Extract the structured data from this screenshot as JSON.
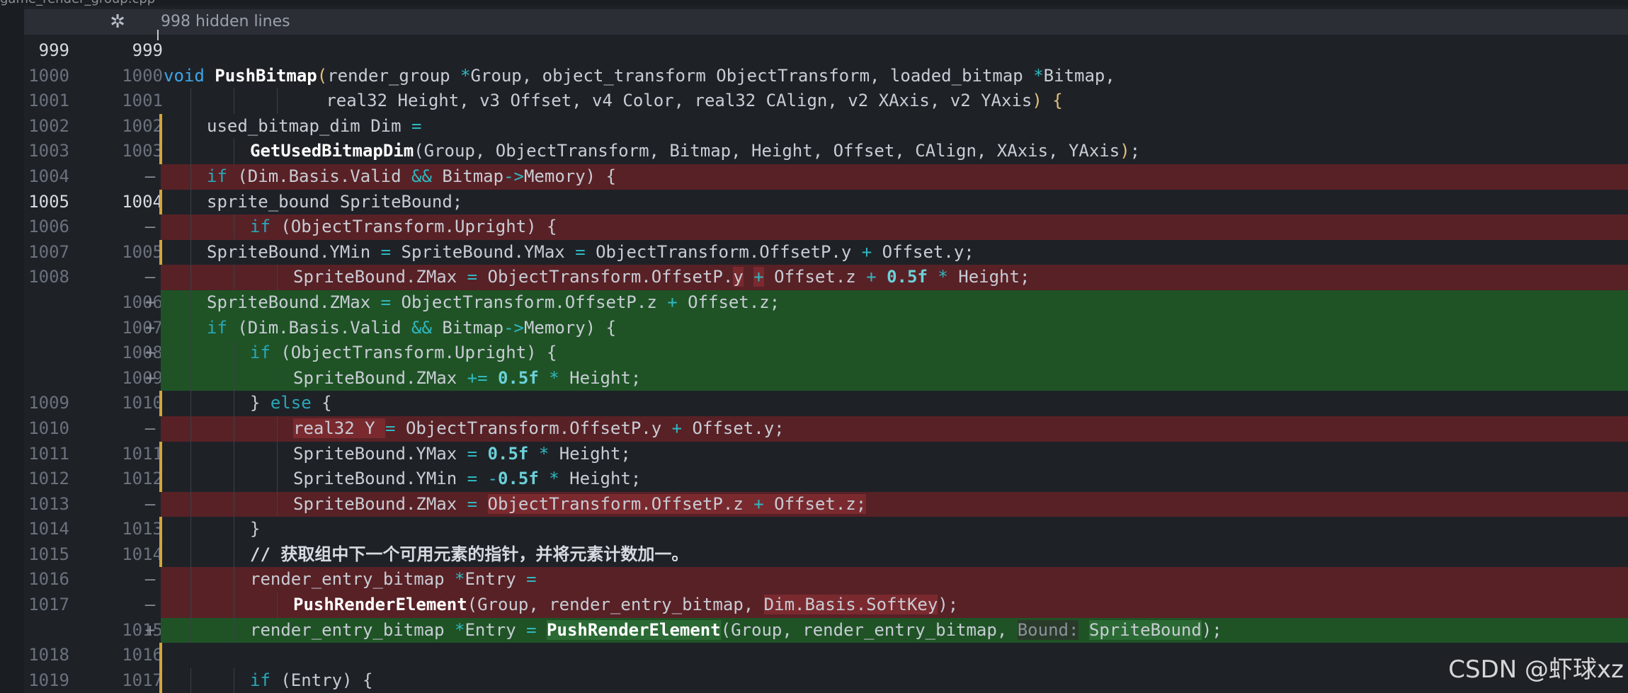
{
  "breadcrumb": "game_render_group.cpp",
  "hidden": {
    "icon": "unfold-icon",
    "label": "998 hidden lines"
  },
  "rows": [
    {
      "old": "999",
      "new": "999",
      "mark": "",
      "type": "ctx",
      "cur": true
    },
    {
      "old": "1000",
      "new": "1000",
      "mark": "",
      "type": "ctx"
    },
    {
      "old": "1001",
      "new": "1001",
      "mark": "",
      "type": "ctx"
    },
    {
      "old": "1002",
      "new": "1002",
      "mark": "",
      "type": "ctx"
    },
    {
      "old": "1003",
      "new": "1003",
      "mark": "",
      "type": "ctx"
    },
    {
      "old": "1004",
      "new": "",
      "mark": "–",
      "type": "del"
    },
    {
      "old": "1005",
      "new": "1004",
      "mark": "",
      "type": "ctx",
      "cur": true
    },
    {
      "old": "1006",
      "new": "",
      "mark": "–",
      "type": "del"
    },
    {
      "old": "1007",
      "new": "1005",
      "mark": "",
      "type": "ctx"
    },
    {
      "old": "1008",
      "new": "",
      "mark": "–",
      "type": "del"
    },
    {
      "old": "",
      "new": "1006",
      "mark": "+",
      "type": "add"
    },
    {
      "old": "",
      "new": "1007",
      "mark": "+",
      "type": "add"
    },
    {
      "old": "",
      "new": "1008",
      "mark": "+",
      "type": "add"
    },
    {
      "old": "",
      "new": "1009",
      "mark": "+",
      "type": "add"
    },
    {
      "old": "1009",
      "new": "1010",
      "mark": "",
      "type": "ctx"
    },
    {
      "old": "1010",
      "new": "",
      "mark": "–",
      "type": "del"
    },
    {
      "old": "1011",
      "new": "1011",
      "mark": "",
      "type": "ctx"
    },
    {
      "old": "1012",
      "new": "1012",
      "mark": "",
      "type": "ctx"
    },
    {
      "old": "1013",
      "new": "",
      "mark": "–",
      "type": "del"
    },
    {
      "old": "1014",
      "new": "1013",
      "mark": "",
      "type": "ctx"
    },
    {
      "old": "1015",
      "new": "1014",
      "mark": "",
      "type": "ctx"
    },
    {
      "old": "1016",
      "new": "",
      "mark": "–",
      "type": "del"
    },
    {
      "old": "1017",
      "new": "",
      "mark": "–",
      "type": "del"
    },
    {
      "old": "",
      "new": "1015",
      "mark": "+",
      "type": "add"
    },
    {
      "old": "1018",
      "new": "1016",
      "mark": "",
      "type": "ctx"
    },
    {
      "old": "1019",
      "new": "1017",
      "mark": "",
      "type": "ctx"
    }
  ],
  "code": {
    "l1000": [
      "void",
      " ",
      "PushBitmap",
      "(",
      "render_group ",
      "*",
      "Group, object_transform ObjectTransform, loaded_bitmap ",
      "*",
      "Bitmap,"
    ],
    "l1001": [
      "real32 Height, v3 Offset, v4 Color, real32 CAlign, v2 XAxis, v2 YAxis",
      ")",
      " ",
      "{"
    ],
    "l1002": [
      "used_bitmap_dim Dim ",
      "="
    ],
    "l1003": [
      "GetUsedBitmapDim",
      "(Group, ObjectTransform, Bitmap, Height, Offset, CAlign, XAxis, YAxis",
      ")",
      ";"
    ],
    "l1004": [
      "if",
      " (Dim.Basis.Valid ",
      "&&",
      " Bitmap",
      "->",
      "Memory) {"
    ],
    "l1005": [
      "sprite_bound SpriteBound;"
    ],
    "l1006": [
      "if",
      " (ObjectTransform.Upright) {"
    ],
    "l1007": [
      "SpriteBound.YMin ",
      "=",
      " SpriteBound.YMax ",
      "=",
      " ObjectTransform.OffsetP.y ",
      "+",
      " Offset.y;"
    ],
    "l1008": [
      "SpriteBound.ZMax ",
      "=",
      " ObjectTransform.OffsetP.",
      "y",
      " ",
      "+",
      " Offset.z ",
      "+",
      " ",
      "0.5",
      "f",
      " ",
      "*",
      " Height;"
    ],
    "a1006": [
      "SpriteBound.ZMax ",
      "=",
      " ObjectTransform.OffsetP.z ",
      "+",
      " Offset.z;"
    ],
    "a1007": [
      "if",
      " (Dim.Basis.Valid ",
      "&&",
      " Bitmap",
      "->",
      "Memory) {"
    ],
    "a1008": [
      "if",
      " (ObjectTransform.Upright) {"
    ],
    "a1009": [
      "SpriteBound.ZMax ",
      "+=",
      " ",
      "0.5",
      "f",
      " ",
      "*",
      " Height;"
    ],
    "l1009": [
      "} ",
      "else",
      " {"
    ],
    "l1010": [
      "real32 Y ",
      "=",
      " ObjectTransform.OffsetP.y ",
      "+",
      " Offset.y;"
    ],
    "l1011": [
      "SpriteBound.YMax ",
      "=",
      " ",
      "0.5",
      "f",
      " ",
      "*",
      " Height;"
    ],
    "l1012": [
      "SpriteBound.YMin ",
      "=",
      " ",
      "-",
      "0.5",
      "f",
      " ",
      "*",
      " Height;"
    ],
    "l1013": [
      "SpriteBound.ZMax ",
      "=",
      " ",
      "ObjectTransform.OffsetP.z ",
      "+",
      " Offset.z;"
    ],
    "l1014": [
      "}"
    ],
    "l1015": [
      "// 获取组中下一个可用元素的指针，并将元素计数加一。"
    ],
    "l1016": [
      "render_entry_bitmap ",
      "*",
      "Entry ",
      "="
    ],
    "l1017": [
      "PushRenderElement",
      "(Group, render_entry_bitmap, ",
      "Dim.Basis.SoftKey",
      ");"
    ],
    "a1015": [
      "render_entry_bitmap ",
      "*",
      "Entry ",
      "=",
      " ",
      "PushRenderElement",
      "(Group, render_entry_bitmap, ",
      "Bound:",
      " ",
      "SpriteBound",
      ");"
    ],
    "l1018": [
      ""
    ],
    "l1019": [
      "if",
      " (Entry) {"
    ]
  },
  "watermark": "CSDN @虾球xz"
}
